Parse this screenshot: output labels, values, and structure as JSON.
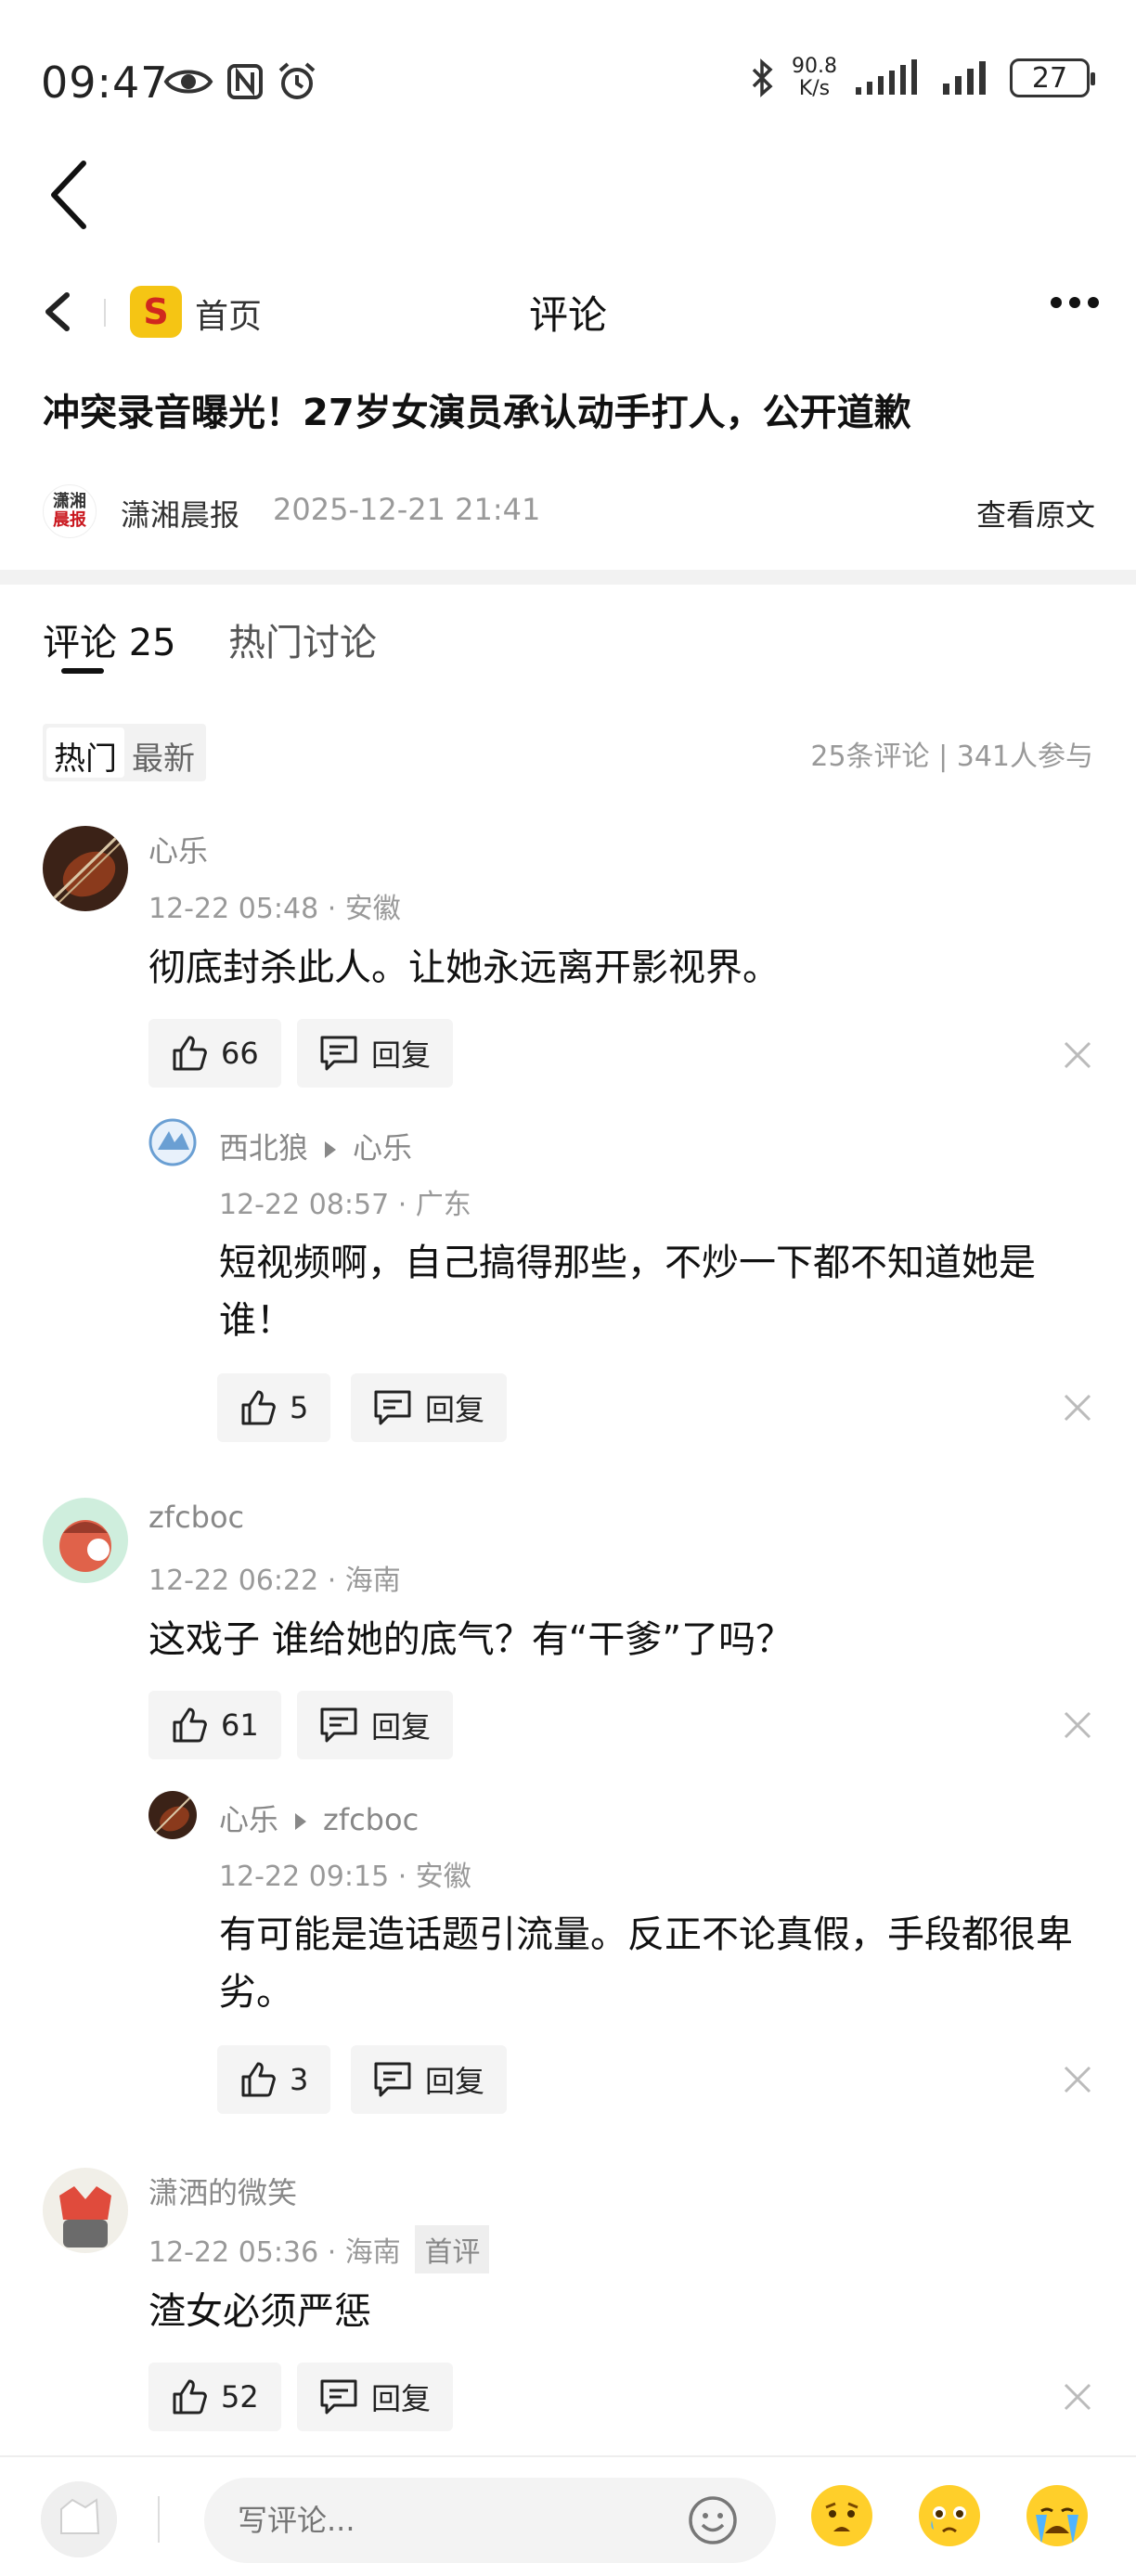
{
  "status_bar": {
    "time": "09:47",
    "net_speed_value": "90.8",
    "net_speed_unit": "K/s",
    "battery": "27"
  },
  "nav": {
    "home_label": "首页",
    "title": "评论"
  },
  "article": {
    "title": "冲突录音曝光！27岁女演员承认动手打人，公开道歉",
    "source_name": "潇湘晨报",
    "date": "2025-12-21 21:41",
    "view_original": "查看原文",
    "source_logo_line1": "潇湘",
    "source_logo_line2": "晨报"
  },
  "tabs": {
    "comments": "评论 25",
    "hot_discussion": "热门讨论"
  },
  "sort": {
    "hot": "热门",
    "latest": "最新",
    "stats": "25条评论 | 341人参与"
  },
  "comments": [
    {
      "name": "心乐",
      "meta": "12-22 05:48 · 安徽",
      "text": "彻底封杀此人。让她永远离开影视界。",
      "likes": "66",
      "reply_label": "回复",
      "reply": {
        "name": "西北狼",
        "to": "心乐",
        "meta": "12-22 08:57 · 广东",
        "text": "短视频啊，自己搞得那些，不炒一下都不知道她是谁！",
        "likes": "5",
        "reply_label": "回复"
      }
    },
    {
      "name": "zfcboc",
      "meta": "12-22 06:22 · 海南",
      "text": "这戏子 谁给她的底气？有“干爹”了吗？",
      "likes": "61",
      "reply_label": "回复",
      "reply": {
        "name": "心乐",
        "to": "zfcboc",
        "meta": "12-22 09:15 · 安徽",
        "text": "有可能是造话题引流量。反正不论真假，手段都很卑劣。",
        "likes": "3",
        "reply_label": "回复"
      }
    },
    {
      "name": "潇洒的微笑",
      "meta": "12-22 05:36 · 海南",
      "badge": "首评",
      "text": "渣女必须严惩",
      "likes": "52",
      "reply_label": "回复"
    }
  ],
  "bottom_bar": {
    "input_placeholder": "写评论..."
  },
  "colors": {
    "logo_yellow": "#f5c514",
    "logo_red": "#d0281e",
    "emoji_yellow": "#ffcf2a"
  }
}
